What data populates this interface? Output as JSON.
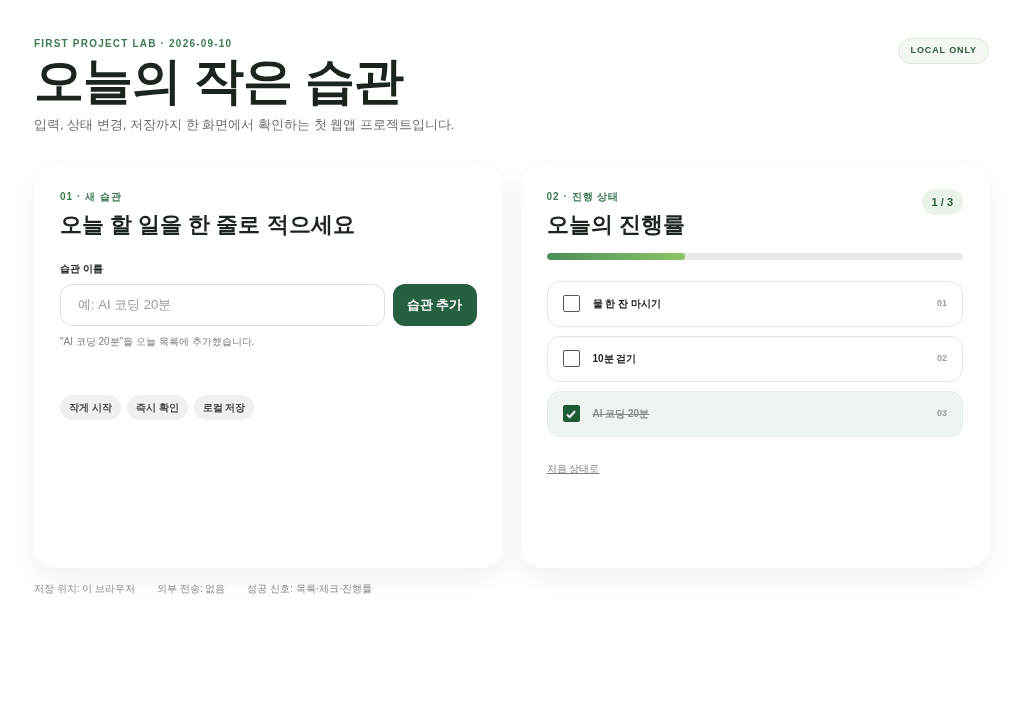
{
  "header": {
    "eyebrow": "FIRST PROJECT LAB · 2026-09-10",
    "title": "오늘의 작은 습관",
    "subtitle": "입력, 상태 변경, 저장까지 한 화면에서 확인하는 첫 웹앱 프로젝트입니다.",
    "badge": "LOCAL ONLY"
  },
  "add_card": {
    "eyebrow": "01 · 새 습관",
    "title": "오늘 할 일을 한 줄로 적으세요",
    "field_label": "습관 이름",
    "placeholder": "예: AI 코딩 20분",
    "button": "습관 추가",
    "message": "\"AI 코딩 20분\"을 오늘 목록에 추가했습니다.",
    "chips": [
      "작게 시작",
      "즉시 확인",
      "로컬 저장"
    ]
  },
  "progress_card": {
    "eyebrow": "02 · 진행 상태",
    "title": "오늘의 진행률",
    "count": "1 / 3",
    "level": 0.333,
    "habits": [
      {
        "label": "물 한 잔 마시기",
        "number": "01",
        "checked": false
      },
      {
        "label": "10분 걷기",
        "number": "02",
        "checked": false
      },
      {
        "label": "AI 코딩 20분",
        "number": "03",
        "checked": true
      }
    ],
    "reset_link": "처음 상태로"
  },
  "footer": [
    "저장 위치: 이 브라우저",
    "외부 전송: 없음",
    "성공 신호: 목록·체크·진행률"
  ]
}
